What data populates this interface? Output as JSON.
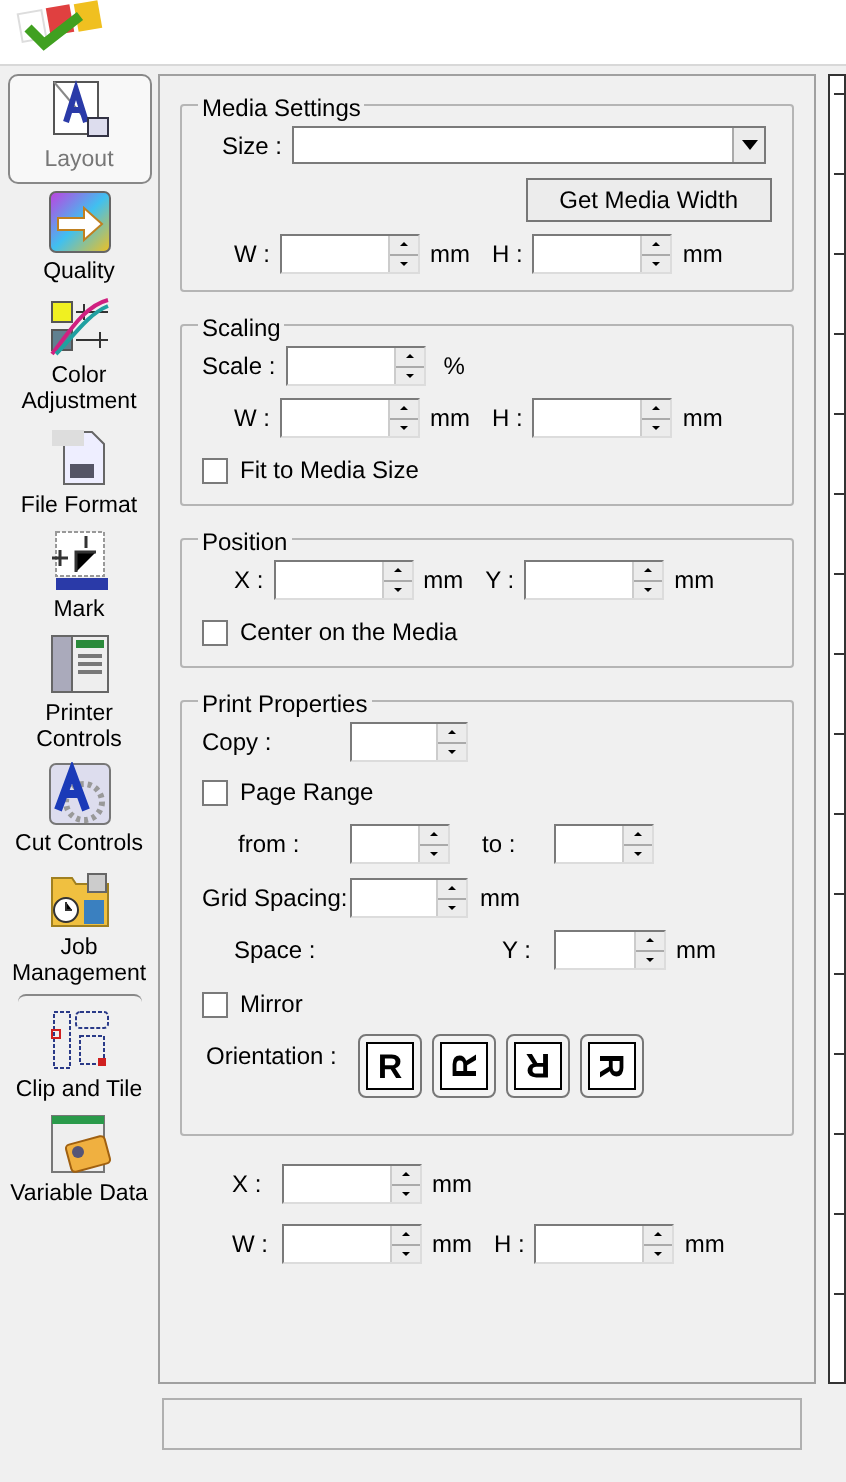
{
  "sidebar": {
    "items": [
      {
        "label": "Layout",
        "kind": "layout",
        "selected": true
      },
      {
        "label": "Quality",
        "kind": "quality",
        "selected": false
      },
      {
        "label": "Color Adjustment",
        "kind": "color",
        "selected": false
      },
      {
        "label": "File Format",
        "kind": "file",
        "selected": false
      },
      {
        "label": "Mark",
        "kind": "mark",
        "selected": false
      },
      {
        "label": "Printer Controls",
        "kind": "printer",
        "selected": false
      },
      {
        "label": "Cut Controls",
        "kind": "cut",
        "selected": false
      },
      {
        "label": "Job Management",
        "kind": "job",
        "selected": false
      },
      {
        "label": "Clip and Tile",
        "kind": "clip",
        "selected": false
      },
      {
        "label": "Variable Data",
        "kind": "variable",
        "selected": false
      }
    ]
  },
  "media_settings": {
    "title": "Media Settings",
    "size_label": "Size :",
    "get_width_button": "Get Media Width",
    "w_label": "W :",
    "w_unit": "mm",
    "h_label": "H :",
    "h_unit": "mm"
  },
  "scaling": {
    "title": "Scaling",
    "scale_label": "Scale :",
    "scale_unit": "%",
    "w_label": "W :",
    "w_unit": "mm",
    "h_label": "H :",
    "h_unit": "mm",
    "fit": {
      "label": "Fit to Media Size",
      "checked": false
    }
  },
  "position": {
    "title": "Position",
    "x_label": "X :",
    "x_unit": "mm",
    "y_label": "Y :",
    "y_unit": "mm",
    "center": {
      "label": "Center on the Media",
      "checked": false
    }
  },
  "print_properties": {
    "title": "Print Properties",
    "copy_label": "Copy :",
    "page_range": {
      "label": "Page Range",
      "checked": false
    },
    "from_label": "from :",
    "to_label": "to :",
    "grid_label": "Grid Spacing:",
    "grid_unit": "mm",
    "space_label": "Space :",
    "y_label": "Y :",
    "y_unit": "mm",
    "mirror": {
      "label": "Mirror",
      "checked": false
    },
    "orientation_label": "Orientation :",
    "orientations": [
      {
        "kind": "portrait",
        "glyph": "R"
      },
      {
        "kind": "landscape",
        "glyph": "R"
      },
      {
        "kind": "reverse-portrait",
        "glyph": "R"
      },
      {
        "kind": "reverse-landscape",
        "glyph": "R"
      }
    ]
  },
  "clip": {
    "x_label": "X :",
    "x_unit": "mm",
    "w_label": "W :",
    "w_unit": "mm",
    "h_label": "H :",
    "h_unit": "mm"
  }
}
